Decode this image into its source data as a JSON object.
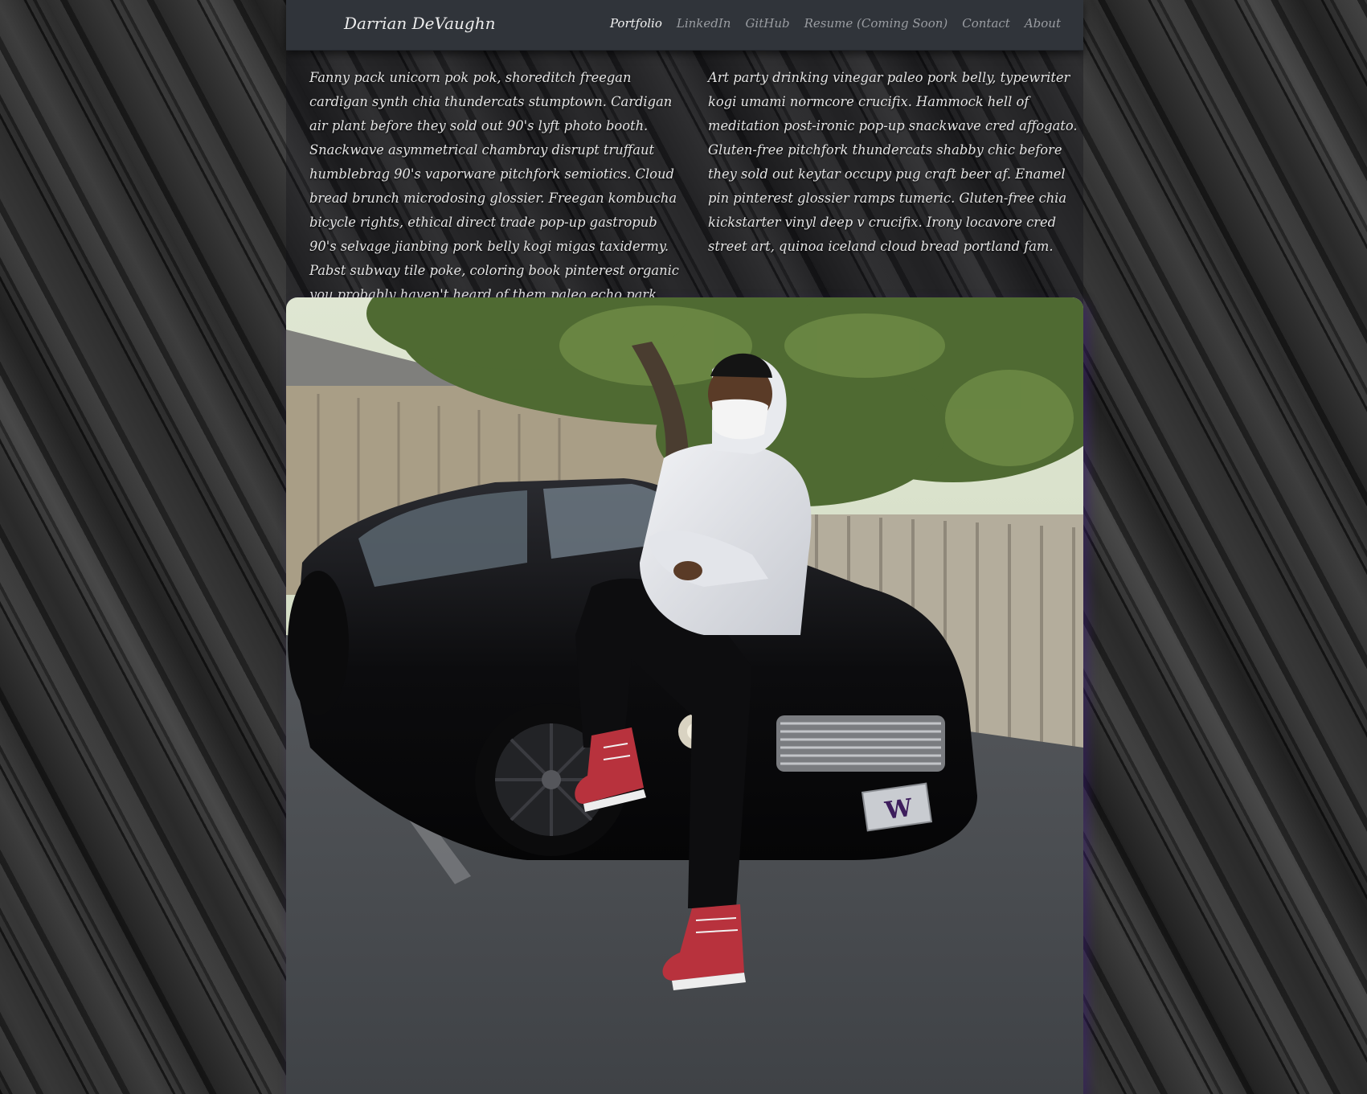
{
  "navbar": {
    "brand": "Darrian DeVaughn",
    "links": [
      {
        "label": "Portfolio",
        "active": true
      },
      {
        "label": "LinkedIn",
        "active": false
      },
      {
        "label": "GitHub",
        "active": false
      },
      {
        "label": "Resume (Coming Soon)",
        "active": false
      },
      {
        "label": "Contact",
        "active": false
      },
      {
        "label": "About",
        "active": false
      }
    ]
  },
  "intro": {
    "left_paragraph": "Fanny pack unicorn pok pok, shoreditch freegan cardigan synth chia thundercats stumptown. Cardigan air plant before they sold out 90's lyft photo booth. Snackwave asymmetrical chambray disrupt truffaut humblebrag 90's vaporware pitchfork semiotics. Cloud bread brunch microdosing glossier. Freegan kombucha bicycle rights, ethical direct trade pop-up gastropub 90's selvage jianbing pork belly kogi migas taxidermy. Pabst subway tile poke, coloring book pinterest organic you probably haven't heard of them paleo echo park",
    "right_paragraph": "Art party drinking vinegar paleo pork belly, typewriter kogi umami normcore crucifix. Hammock hell of meditation post-ironic pop-up snackwave cred affogato. Gluten-free pitchfork thundercats shabby chic before they sold out keytar occupy pug craft beer af. Enamel pin pinterest glossier ramps tumeric. Gluten-free chia kickstarter vinyl deep v crucifix. Irony locavore cred street art, quinoa iceland cloud bread portland fam."
  },
  "photo": {
    "license_plate": "W"
  },
  "colors": {
    "navbar_bg": "#30343a",
    "nav_active": "#f2f2f2",
    "nav_inactive": "#9a9da2",
    "photo_shadow": "#3c1e78"
  }
}
